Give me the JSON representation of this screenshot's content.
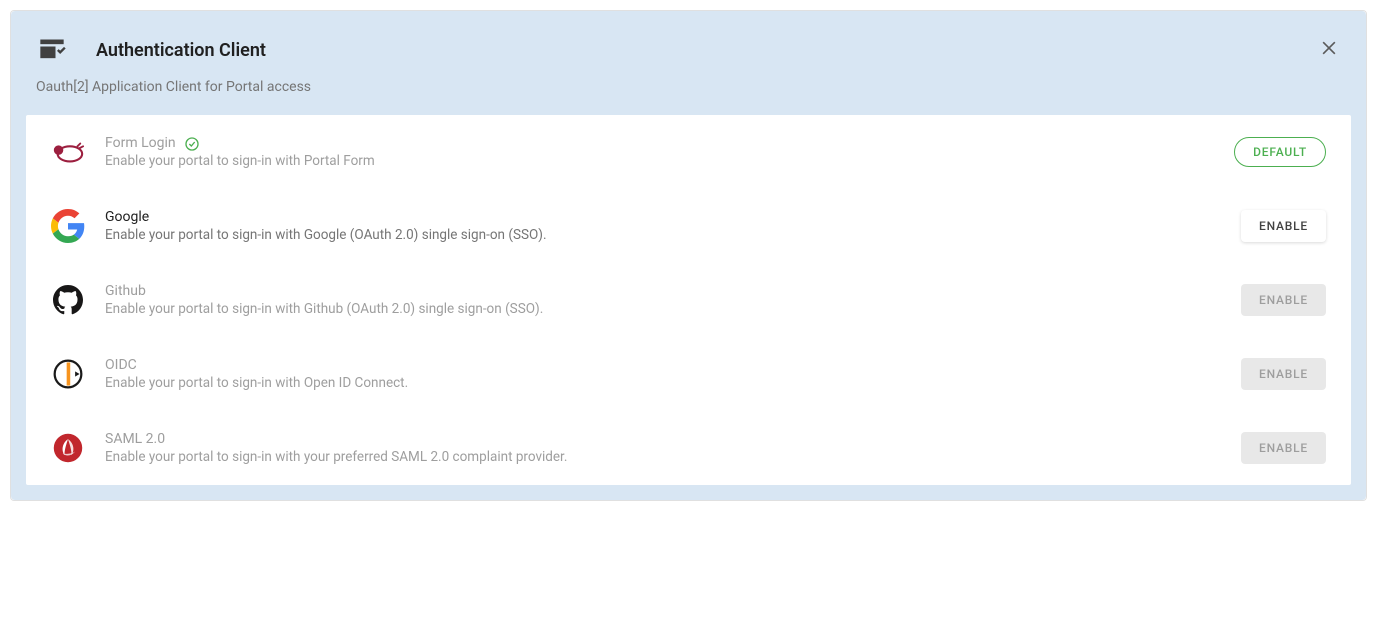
{
  "header": {
    "title": "Authentication Client",
    "subtitle": "Oauth[2] Application Client for Portal access"
  },
  "buttons": {
    "default": "DEFAULT",
    "enable": "ENABLE"
  },
  "providers": [
    {
      "title": "Form Login",
      "desc": "Enable your portal to sign-in with Portal Form"
    },
    {
      "title": "Google",
      "desc": "Enable your portal to sign-in with Google (OAuth 2.0) single sign-on (SSO)."
    },
    {
      "title": "Github",
      "desc": "Enable your portal to sign-in with Github (OAuth 2.0) single sign-on (SSO)."
    },
    {
      "title": "OIDC",
      "desc": "Enable your portal to sign-in with Open ID Connect."
    },
    {
      "title": "SAML 2.0",
      "desc": "Enable your portal to sign-in with your preferred SAML 2.0 complaint provider."
    }
  ]
}
